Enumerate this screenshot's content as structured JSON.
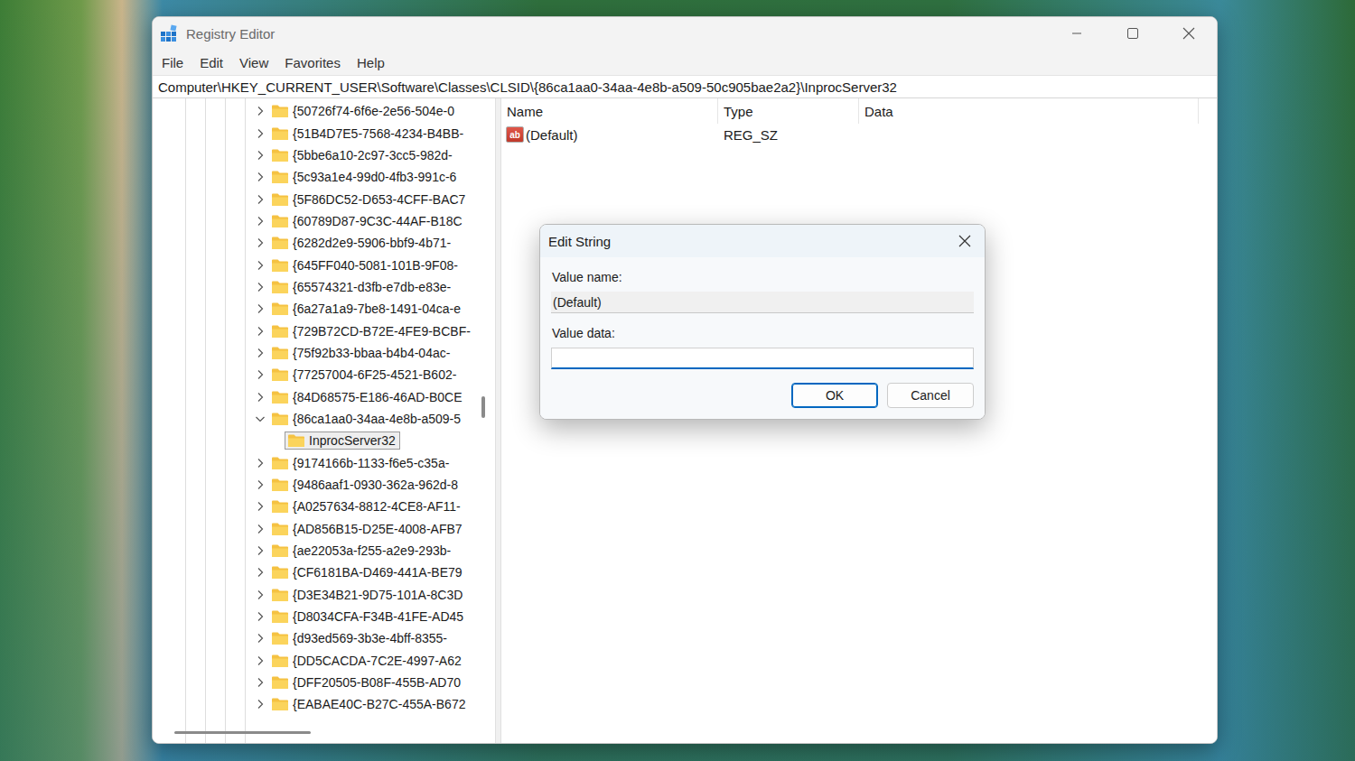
{
  "window": {
    "title": "Registry Editor"
  },
  "menu": [
    "File",
    "Edit",
    "View",
    "Favorites",
    "Help"
  ],
  "address": "Computer\\HKEY_CURRENT_USER\\Software\\Classes\\CLSID\\{86ca1aa0-34aa-4e8b-a509-50c905bae2a2}\\InprocServer32",
  "tree": [
    {
      "label": "{50726f74-6f6e-2e56-504e-0",
      "kind": "key",
      "expanded": false,
      "selected": false
    },
    {
      "label": "{51B4D7E5-7568-4234-B4BB-",
      "kind": "key",
      "expanded": false,
      "selected": false
    },
    {
      "label": "{5bbe6a10-2c97-3cc5-982d-",
      "kind": "key",
      "expanded": false,
      "selected": false
    },
    {
      "label": "{5c93a1e4-99d0-4fb3-991c-6",
      "kind": "key",
      "expanded": false,
      "selected": false
    },
    {
      "label": "{5F86DC52-D653-4CFF-BAC7",
      "kind": "key",
      "expanded": false,
      "selected": false
    },
    {
      "label": "{60789D87-9C3C-44AF-B18C",
      "kind": "key",
      "expanded": false,
      "selected": false
    },
    {
      "label": "{6282d2e9-5906-bbf9-4b71-",
      "kind": "key",
      "expanded": false,
      "selected": false
    },
    {
      "label": "{645FF040-5081-101B-9F08-",
      "kind": "key",
      "expanded": false,
      "selected": false
    },
    {
      "label": "{65574321-d3fb-e7db-e83e-",
      "kind": "key",
      "expanded": false,
      "selected": false
    },
    {
      "label": "{6a27a1a9-7be8-1491-04ca-e",
      "kind": "key",
      "expanded": false,
      "selected": false
    },
    {
      "label": "{729B72CD-B72E-4FE9-BCBF-",
      "kind": "key",
      "expanded": false,
      "selected": false
    },
    {
      "label": "{75f92b33-bbaa-b4b4-04ac-",
      "kind": "key",
      "expanded": false,
      "selected": false
    },
    {
      "label": "{77257004-6F25-4521-B602-",
      "kind": "key",
      "expanded": false,
      "selected": false
    },
    {
      "label": "{84D68575-E186-46AD-B0CE",
      "kind": "key",
      "expanded": false,
      "selected": false
    },
    {
      "label": "{86ca1aa0-34aa-4e8b-a509-5",
      "kind": "key",
      "expanded": true,
      "selected": false
    },
    {
      "label": "InprocServer32",
      "kind": "child",
      "expanded": false,
      "selected": true
    },
    {
      "label": "{9174166b-1133-f6e5-c35a-",
      "kind": "key",
      "expanded": false,
      "selected": false
    },
    {
      "label": "{9486aaf1-0930-362a-962d-8",
      "kind": "key",
      "expanded": false,
      "selected": false
    },
    {
      "label": "{A0257634-8812-4CE8-AF11-",
      "kind": "key",
      "expanded": false,
      "selected": false
    },
    {
      "label": "{AD856B15-D25E-4008-AFB7",
      "kind": "key",
      "expanded": false,
      "selected": false
    },
    {
      "label": "{ae22053a-f255-a2e9-293b-",
      "kind": "key",
      "expanded": false,
      "selected": false
    },
    {
      "label": "{CF6181BA-D469-441A-BE79",
      "kind": "key",
      "expanded": false,
      "selected": false
    },
    {
      "label": "{D3E34B21-9D75-101A-8C3D",
      "kind": "key",
      "expanded": false,
      "selected": false
    },
    {
      "label": "{D8034CFA-F34B-41FE-AD45",
      "kind": "key",
      "expanded": false,
      "selected": false
    },
    {
      "label": "{d93ed569-3b3e-4bff-8355-",
      "kind": "key",
      "expanded": false,
      "selected": false
    },
    {
      "label": "{DD5CACDA-7C2E-4997-A62",
      "kind": "key",
      "expanded": false,
      "selected": false
    },
    {
      "label": "{DFF20505-B08F-455B-AD70",
      "kind": "key",
      "expanded": false,
      "selected": false
    },
    {
      "label": "{EABAE40C-B27C-455A-B672",
      "kind": "key",
      "expanded": false,
      "selected": false
    }
  ],
  "values": {
    "columns": [
      "Name",
      "Type",
      "Data"
    ],
    "rows": [
      {
        "icon": "ab",
        "name": "(Default)",
        "type": "REG_SZ",
        "data": "",
        "selected": false
      }
    ]
  },
  "dialog": {
    "title": "Edit String",
    "name_label": "Value name:",
    "name_value": "(Default)",
    "data_label": "Value data:",
    "data_value": "",
    "data_focused": true,
    "buttons": [
      {
        "label": "OK",
        "default": true
      },
      {
        "label": "Cancel",
        "default": false
      }
    ]
  }
}
